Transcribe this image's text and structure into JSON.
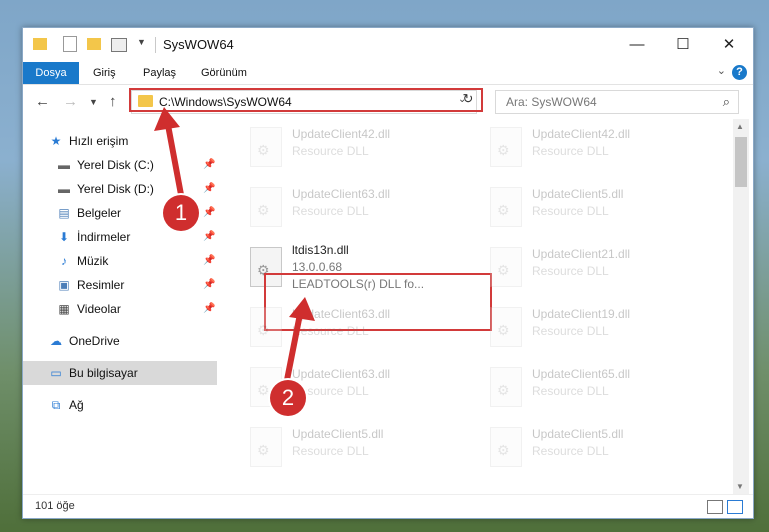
{
  "window": {
    "title": "SysWOW64"
  },
  "ribbon": {
    "tabs": [
      "Dosya",
      "Giriş",
      "Paylaş",
      "Görünüm"
    ],
    "help_label": "?"
  },
  "navbar": {
    "path": "C:\\Windows\\SysWOW64",
    "search_placeholder": "Ara: SysWOW64"
  },
  "sidebar": {
    "items": [
      {
        "label": "Hızlı erişim",
        "icon": "star-icon"
      },
      {
        "label": "Yerel Disk (C:)",
        "icon": "drive-icon"
      },
      {
        "label": "Yerel Disk (D:)",
        "icon": "drive-icon"
      },
      {
        "label": "Belgeler",
        "icon": "documents-icon"
      },
      {
        "label": "İndirmeler",
        "icon": "download-icon"
      },
      {
        "label": "Müzik",
        "icon": "music-icon"
      },
      {
        "label": "Resimler",
        "icon": "pictures-icon"
      },
      {
        "label": "Videolar",
        "icon": "video-icon"
      },
      {
        "label": "OneDrive",
        "icon": "cloud-icon"
      },
      {
        "label": "Bu bilgisayar",
        "icon": "computer-icon"
      },
      {
        "label": "Ağ",
        "icon": "network-icon"
      }
    ]
  },
  "files": {
    "left": [
      {
        "name": "UpdateClient42.dll",
        "desc": "Resource DLL"
      },
      {
        "name": "UpdateClient63.dll",
        "desc": "Resource DLL"
      },
      {
        "name": "ltdis13n.dll",
        "desc": "13.0.0.68",
        "sub": "LEADTOOLS(r) DLL fo..."
      },
      {
        "name": "UpdateClient63.dll",
        "desc": "Resource DLL"
      },
      {
        "name": "UpdateClient63.dll",
        "desc": "Resource DLL"
      },
      {
        "name": "UpdateClient5.dll",
        "desc": "Resource DLL"
      }
    ],
    "right": [
      {
        "name": "UpdateClient42.dll",
        "desc": "Resource DLL"
      },
      {
        "name": "UpdateClient5.dll",
        "desc": "Resource DLL"
      },
      {
        "name": "UpdateClient21.dll",
        "desc": "Resource DLL"
      },
      {
        "name": "UpdateClient19.dll",
        "desc": "Resource DLL"
      },
      {
        "name": "UpdateClient65.dll",
        "desc": "Resource DLL"
      },
      {
        "name": "UpdateClient5.dll",
        "desc": "Resource DLL"
      }
    ]
  },
  "status": {
    "count": "101 öğe"
  },
  "badges": {
    "one": "1",
    "two": "2"
  },
  "colors": {
    "accent": "#1979ca",
    "highlight": "#d23a3a"
  }
}
